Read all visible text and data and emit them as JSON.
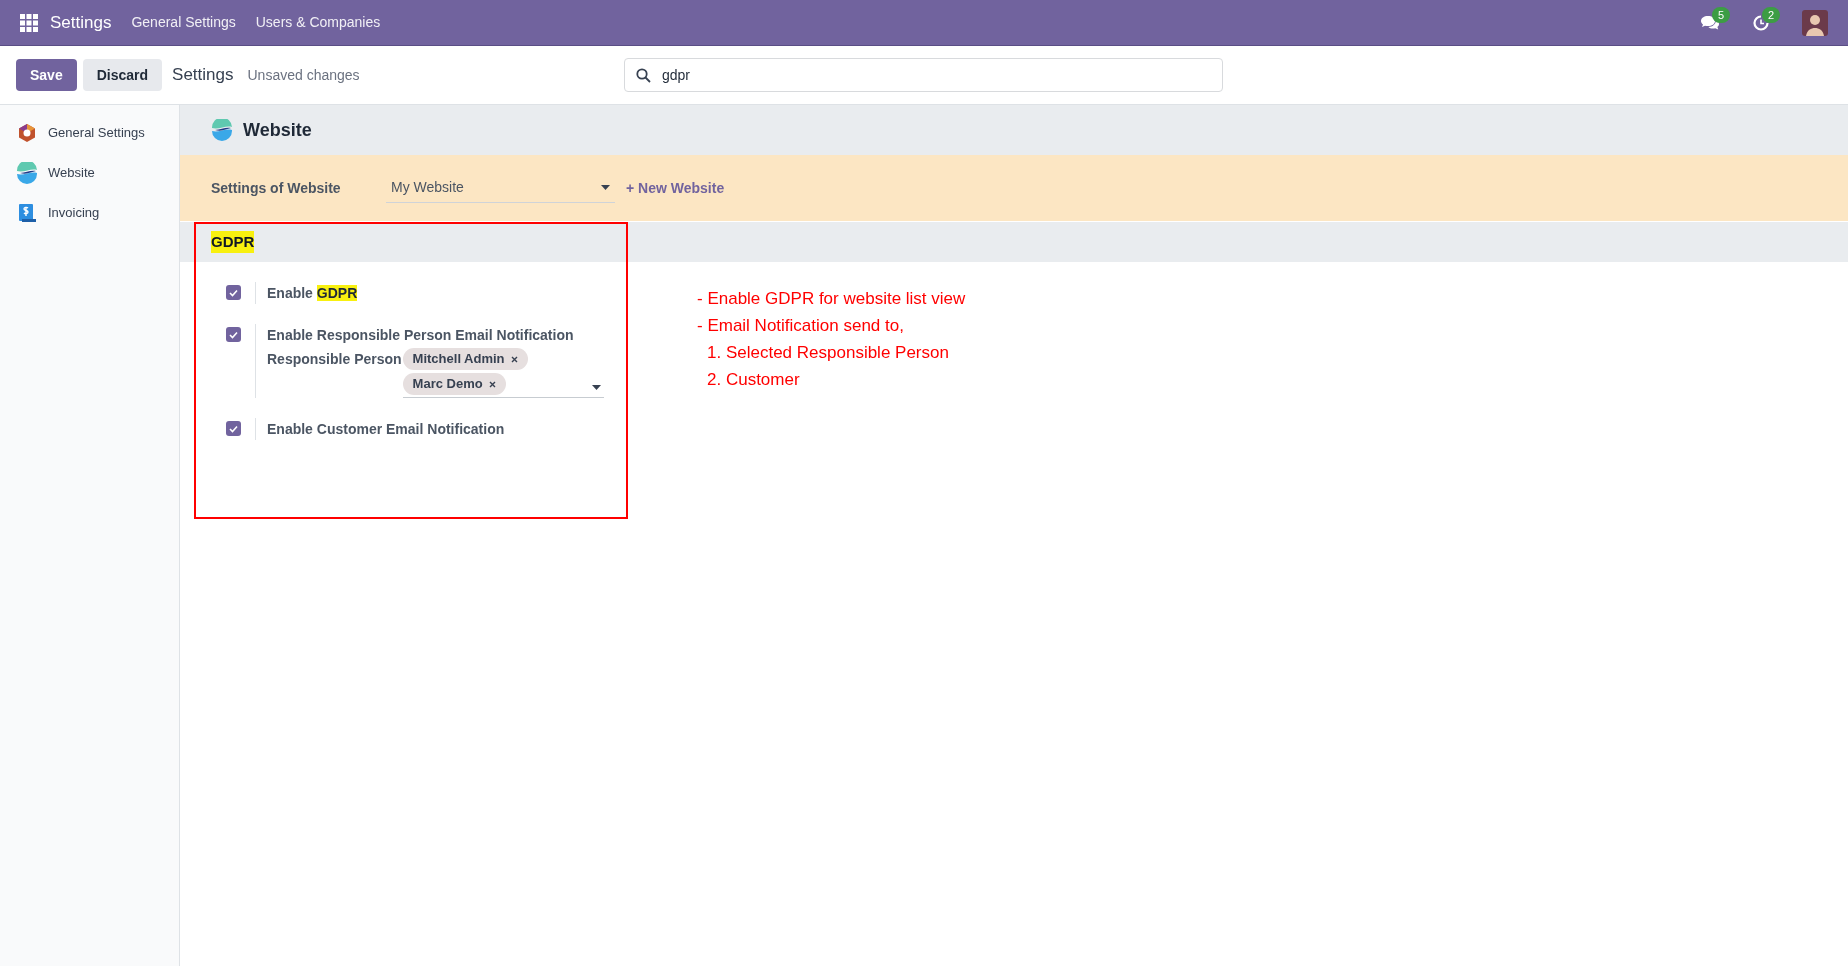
{
  "navbar": {
    "app_title": "Settings",
    "menu": [
      "General Settings",
      "Users & Companies"
    ],
    "messages_badge": "5",
    "activities_badge": "2"
  },
  "control_panel": {
    "buttons": [
      {
        "label": "Save",
        "kind": "primary"
      },
      {
        "label": "Discard",
        "kind": "secondary"
      }
    ],
    "breadcrumb": "Settings",
    "status": "Unsaved changes",
    "search": {
      "value": "gdpr"
    }
  },
  "sidebar": {
    "items": [
      {
        "label": "General Settings",
        "kind": "general"
      },
      {
        "label": "Website",
        "kind": "website"
      },
      {
        "label": "Invoicing",
        "kind": "invoicing"
      }
    ]
  },
  "section": {
    "title": "Website",
    "website_setting": {
      "label": "Settings of Website",
      "value": "My Website",
      "new_link": "+ New Website"
    },
    "group": {
      "title": "GDPR",
      "highlighted": true,
      "settings": [
        {
          "checked": true,
          "label": [
            {
              "text": "Enable ",
              "highlighted": false
            },
            {
              "text": "GDPR",
              "highlighted": true
            }
          ]
        },
        {
          "checked": true,
          "label": [
            {
              "text": "Enable Responsible Person Email Notification",
              "highlighted": false
            }
          ],
          "field": {
            "label": "Responsible Person",
            "tags": [
              "Mitchell Admin",
              "Marc Demo"
            ]
          }
        },
        {
          "checked": true,
          "label": [
            {
              "text": "Enable Customer Email Notification",
              "highlighted": false
            }
          ]
        }
      ]
    }
  },
  "annotation": {
    "lines": [
      {
        "text": "- Enable GDPR for website list view"
      },
      {
        "text": "- Email Notification send to,",
        "children": [
          {
            "text": "1. Selected Responsible Person"
          },
          {
            "text": "2. Customer"
          }
        ]
      }
    ]
  }
}
